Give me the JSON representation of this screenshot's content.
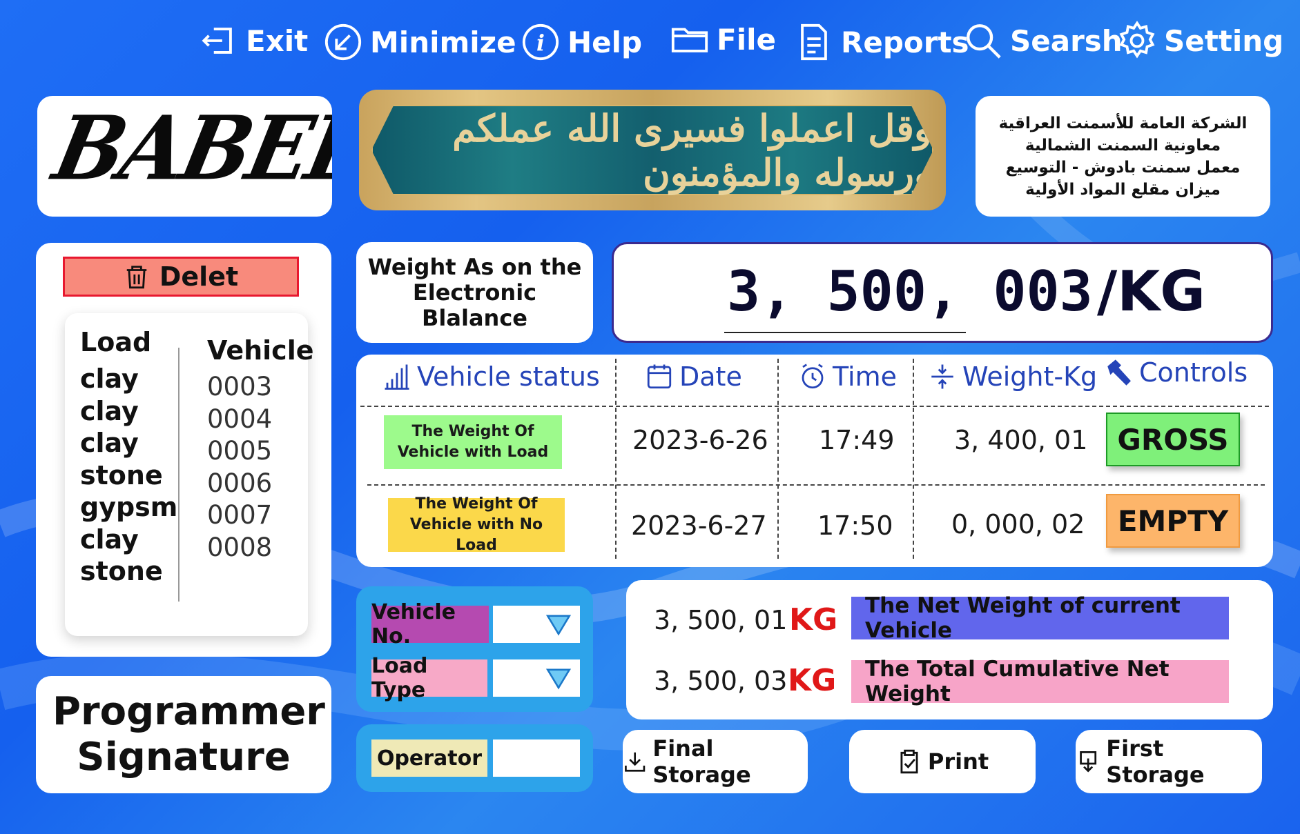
{
  "menu": {
    "exit": "Exit",
    "minimize": "Minimize",
    "help": "Help",
    "file": "File",
    "reports": "Reports",
    "search": "Searsh",
    "setting": "Setting"
  },
  "logo": {
    "text": "BABEL"
  },
  "banner": {
    "calligraphy": "وقل اعملوا فسيرى الله عملكم ورسوله والمؤمنون"
  },
  "org": {
    "lines": [
      "الشركة العامة للأسمنت العراقية",
      "معاونية السمنت الشمالية",
      "معمل سمنت بادوش - التوسيع",
      "ميزان مقلع المواد الأولية"
    ]
  },
  "list": {
    "delete_label": "Delet",
    "load_header": "Load",
    "vehicle_header": "Vehicle",
    "loads": [
      "clay",
      "clay",
      "clay",
      "stone",
      "gypsm",
      "clay",
      "stone"
    ],
    "vehicles": [
      "0003",
      "0004",
      "0005",
      "0006",
      "0007",
      "0008"
    ]
  },
  "signature": {
    "text": "Programmer Signature"
  },
  "balance": {
    "label": "Weight As on the Electronic Blalance",
    "value": "3, 500, 003",
    "unit": "/KG"
  },
  "table": {
    "headers": {
      "status": "Vehicle status",
      "date": "Date",
      "time": "Time",
      "weight": "Weight-Kg",
      "controls": "Controls"
    },
    "rows": [
      {
        "status": "The Weight Of Vehicle with Load",
        "date": "2023-6-26",
        "time": "17:49",
        "weight": "3, 400, 01",
        "control": "GROSS"
      },
      {
        "status": "The Weight Of Vehicle with No Load",
        "date": "2023-6-27",
        "time": "17:50",
        "weight": "0, 000, 02",
        "control": "EMPTY"
      }
    ]
  },
  "form": {
    "vehicle_no": "Vehicle No.",
    "load_type": "Load Type",
    "operator": "Operator"
  },
  "net": {
    "current_value": "3, 500, 01",
    "current_unit": "KG",
    "current_label": "The Net Weight of current Vehicle",
    "total_value": "3, 500, 03",
    "total_unit": "KG",
    "total_label": "The Total Cumulative Net Weight"
  },
  "buttons": {
    "final_storage": "Final Storage",
    "print": "Print",
    "first_storage": "First Storage"
  },
  "colors": {
    "background": "#1f6ef5",
    "gross": "#7ff07a",
    "empty": "#fdb56a",
    "status_load": "#9dfa8c",
    "status_noload": "#fbd84a",
    "vehicle_label": "#b54ab0",
    "load_label": "#f7a9c7",
    "operator_label": "#efe9b6",
    "net_current": "#6166ec",
    "net_total": "#f7a4c8",
    "delete": "#f88a7c"
  }
}
